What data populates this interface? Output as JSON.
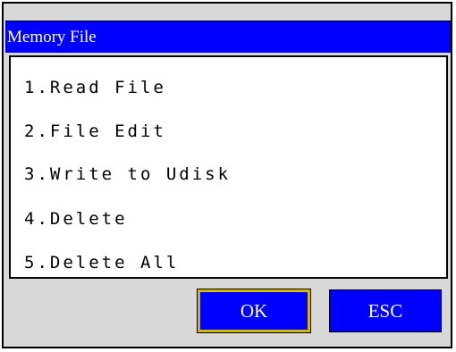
{
  "window": {
    "title": "Memory File"
  },
  "menu": {
    "items": [
      {
        "label": "1.Read File"
      },
      {
        "label": "2.File Edit"
      },
      {
        "label": "3.Write to Udisk"
      },
      {
        "label": "4.Delete"
      },
      {
        "label": "5.Delete All"
      }
    ]
  },
  "buttons": {
    "ok_label": "OK",
    "esc_label": "ESC"
  },
  "colors": {
    "title_bar": "#0000ff",
    "button": "#0000ff",
    "focus_border": "#d4b800",
    "panel_background": "#d8d8d8"
  }
}
